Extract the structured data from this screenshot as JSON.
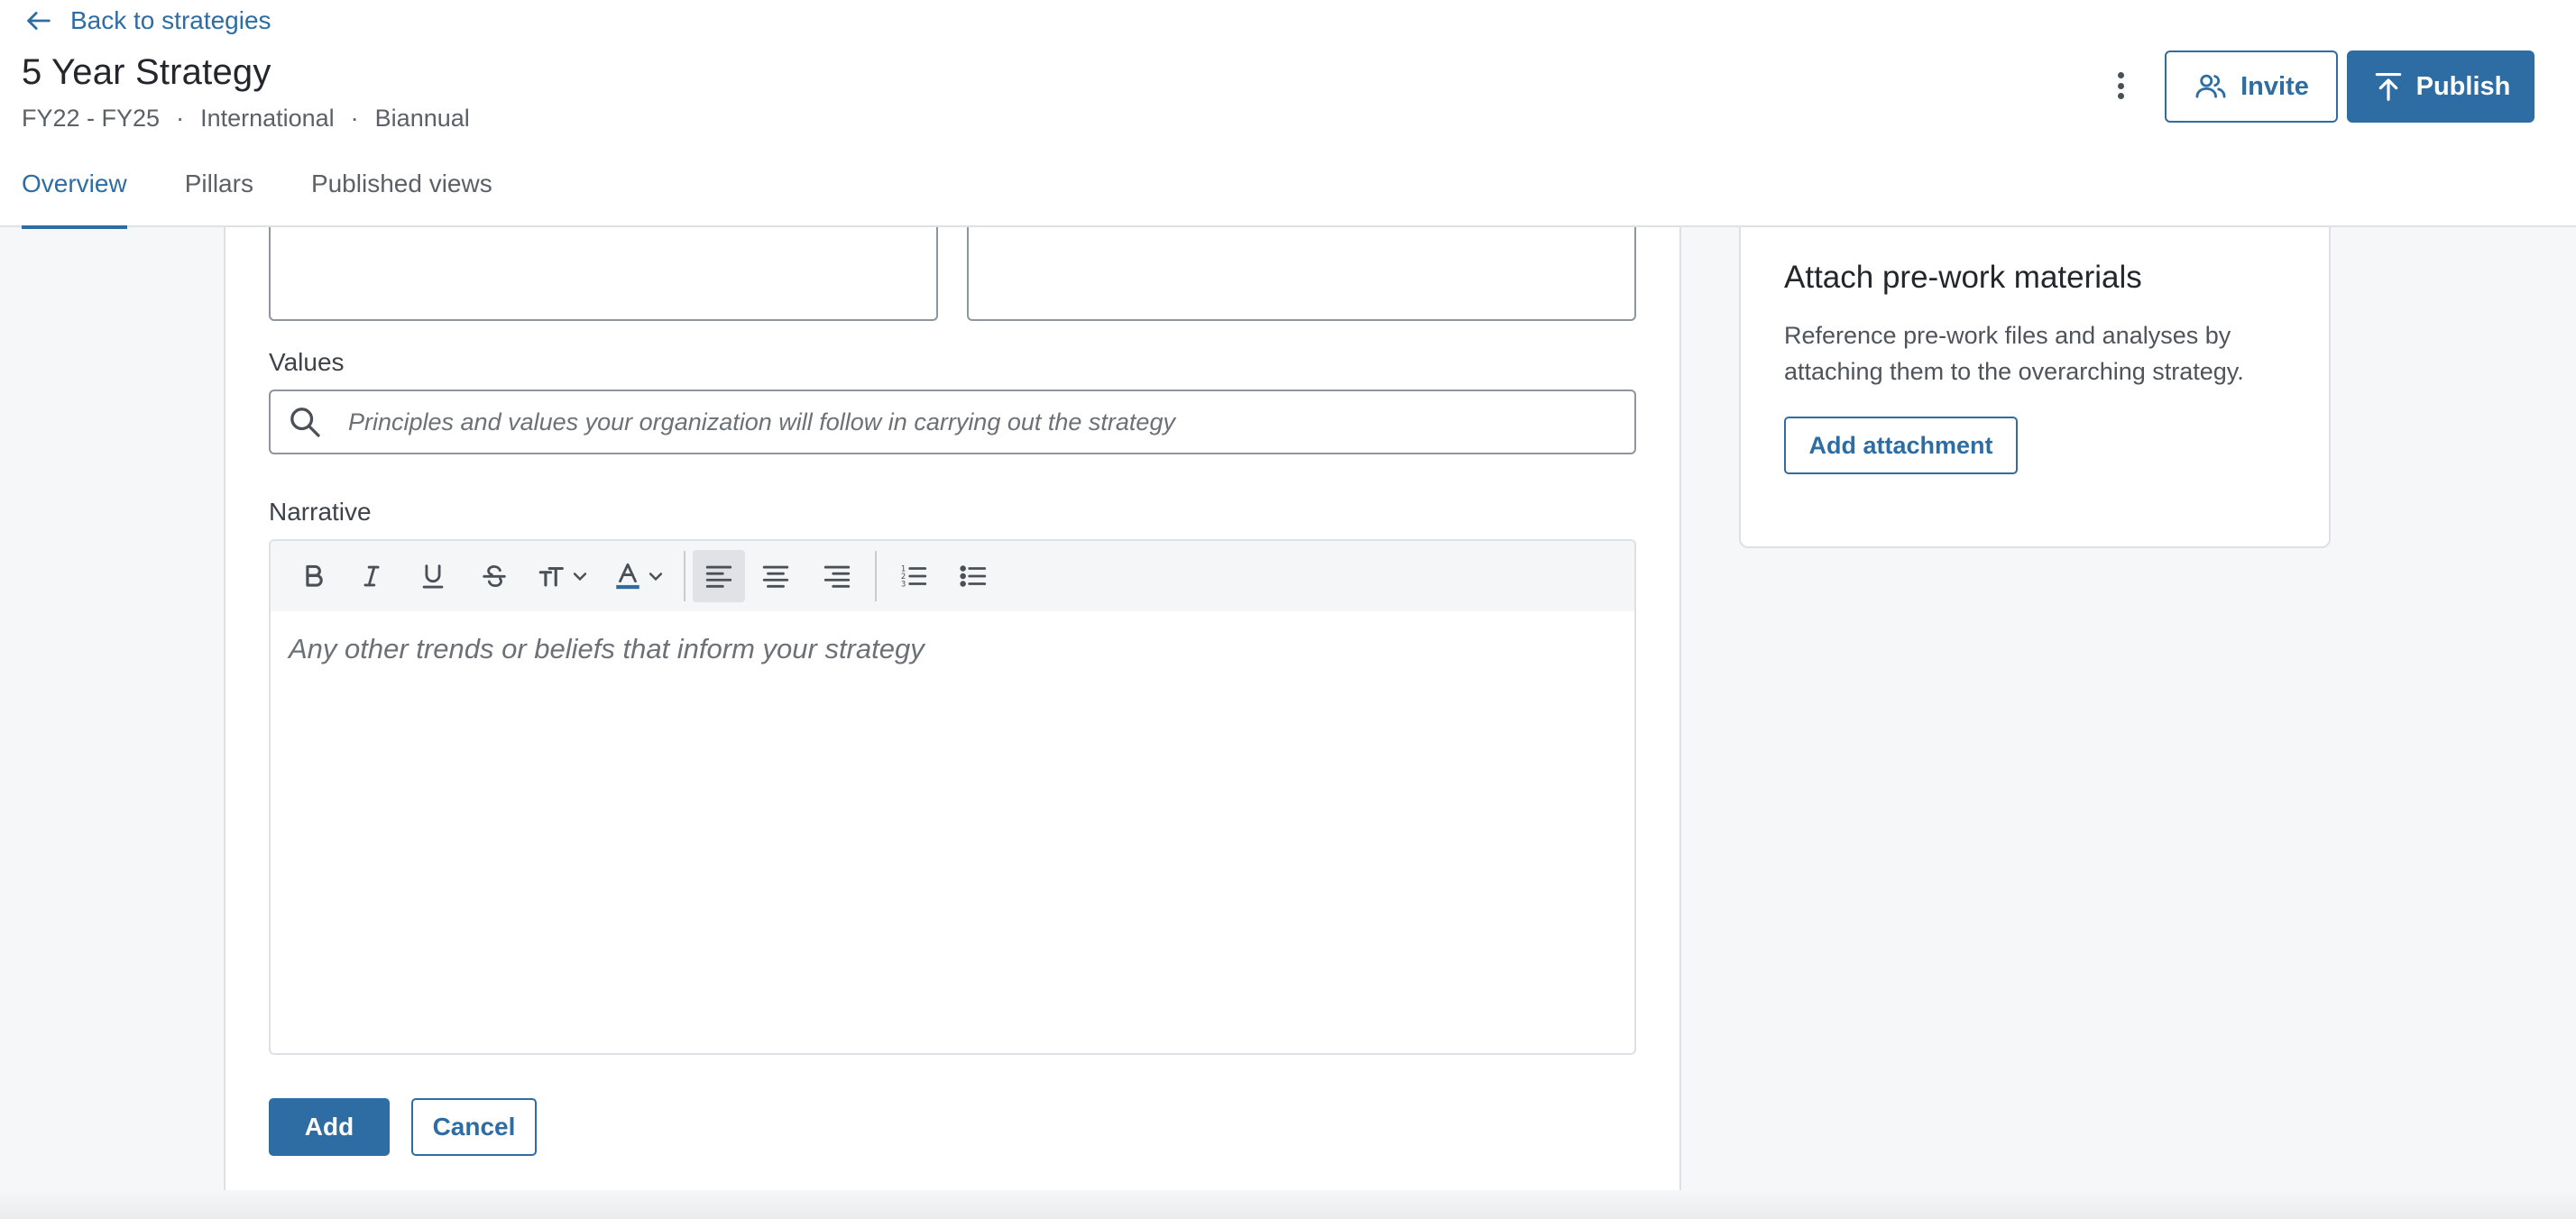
{
  "header": {
    "back_label": "Back to strategies",
    "title": "5 Year Strategy",
    "meta": [
      "FY22 - FY25",
      "International",
      "Biannual"
    ],
    "meta_separator": "·",
    "invite_label": "Invite",
    "publish_label": "Publish"
  },
  "tabs": [
    {
      "label": "Overview",
      "active": true
    },
    {
      "label": "Pillars",
      "active": false
    },
    {
      "label": "Published views",
      "active": false
    }
  ],
  "form": {
    "values_label": "Values",
    "values_placeholder": "Principles and values your organization will follow in carrying out the strategy",
    "narrative_label": "Narrative",
    "narrative_placeholder": "Any other trends or beliefs that inform your strategy",
    "toolbar_icons": [
      "bold-icon",
      "italic-icon",
      "underline-icon",
      "strikethrough-icon",
      "font-size-icon",
      "text-color-icon",
      "align-left-icon",
      "align-center-icon",
      "align-right-icon",
      "ordered-list-icon",
      "bullet-list-icon"
    ],
    "add_label": "Add",
    "cancel_label": "Cancel"
  },
  "side_card": {
    "title": "Attach pre-work materials",
    "description": "Reference pre-work files and analyses by attaching them to the overarching strategy.",
    "button_label": "Add attachment"
  },
  "colors": {
    "accent": "#2e6da4",
    "background": "#f5f7f9",
    "border": "#dde1e5"
  }
}
